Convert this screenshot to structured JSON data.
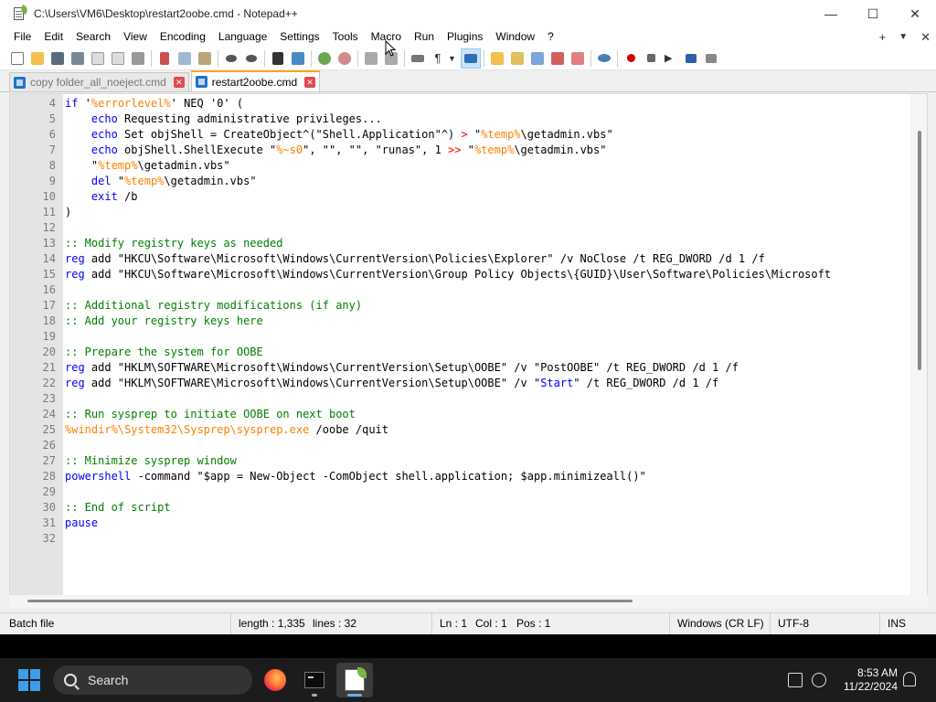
{
  "window": {
    "title": "C:\\Users\\VM6\\Desktop\\restart2oobe.cmd - Notepad++",
    "controls": {
      "minimize": "—",
      "maximize": "☐",
      "close": "✕"
    }
  },
  "menu": {
    "items": [
      "File",
      "Edit",
      "Search",
      "View",
      "Encoding",
      "Language",
      "Settings",
      "Tools",
      "Macro",
      "Run",
      "Plugins",
      "Window",
      "?"
    ],
    "right": {
      "add": "+",
      "dropdown": "▼",
      "close": "✕"
    }
  },
  "tabs": [
    {
      "label": "copy folder_all_noeject.cmd",
      "active": false
    },
    {
      "label": "restart2oobe.cmd",
      "active": true
    }
  ],
  "code_lines": [
    {
      "n": "4",
      "segs": [
        [
          "kw",
          "if "
        ],
        [
          "",
          "'"
        ],
        [
          "var",
          "%errorlevel%"
        ],
        [
          "",
          "' NEQ '0' ("
        ]
      ]
    },
    {
      "n": "5",
      "segs": [
        [
          "",
          "    "
        ],
        [
          "kw",
          "echo"
        ],
        [
          "",
          " Requesting administrative privileges..."
        ]
      ]
    },
    {
      "n": "6",
      "segs": [
        [
          "",
          "    "
        ],
        [
          "kw",
          "echo"
        ],
        [
          "",
          " Set objShell = CreateObject^(\"Shell.Application\"^) "
        ],
        [
          "op",
          ">"
        ],
        [
          "",
          " \""
        ],
        [
          "var",
          "%temp%"
        ],
        [
          "",
          "\\getadmin.vbs\""
        ]
      ]
    },
    {
      "n": "7",
      "segs": [
        [
          "",
          "    "
        ],
        [
          "kw",
          "echo"
        ],
        [
          "",
          " objShell.ShellExecute \""
        ],
        [
          "var",
          "%~s0"
        ],
        [
          "",
          "\", \"\", \"\", \"runas\", 1 "
        ],
        [
          "op",
          ">>"
        ],
        [
          "",
          " \""
        ],
        [
          "var",
          "%temp%"
        ],
        [
          "",
          "\\getadmin.vbs\""
        ]
      ]
    },
    {
      "n": "8",
      "segs": [
        [
          "",
          "    \""
        ],
        [
          "var",
          "%temp%"
        ],
        [
          "",
          "\\getadmin.vbs\""
        ]
      ]
    },
    {
      "n": "9",
      "segs": [
        [
          "",
          "    "
        ],
        [
          "kw",
          "del"
        ],
        [
          "",
          " \""
        ],
        [
          "var",
          "%temp%"
        ],
        [
          "",
          "\\getadmin.vbs\""
        ]
      ]
    },
    {
      "n": "10",
      "segs": [
        [
          "",
          "    "
        ],
        [
          "kw",
          "exit"
        ],
        [
          "",
          " /b"
        ]
      ]
    },
    {
      "n": "11",
      "segs": [
        [
          "",
          ")"
        ]
      ]
    },
    {
      "n": "12",
      "segs": []
    },
    {
      "n": "13",
      "segs": [
        [
          "cm",
          ":: Modify registry keys as needed"
        ]
      ]
    },
    {
      "n": "14",
      "segs": [
        [
          "kw",
          "reg"
        ],
        [
          "",
          " add \"HKCU\\Software\\Microsoft\\Windows\\CurrentVersion\\Policies\\Explorer\" /v NoClose /t REG_DWORD /d 1 /f"
        ]
      ]
    },
    {
      "n": "15",
      "segs": [
        [
          "kw",
          "reg"
        ],
        [
          "",
          " add \"HKCU\\Software\\Microsoft\\Windows\\CurrentVersion\\Group Policy Objects\\{GUID}\\User\\Software\\Policies\\Microsoft"
        ]
      ]
    },
    {
      "n": "16",
      "segs": []
    },
    {
      "n": "17",
      "segs": [
        [
          "cm",
          ":: Additional registry modifications (if any)"
        ]
      ]
    },
    {
      "n": "18",
      "segs": [
        [
          "cm",
          ":: Add your registry keys here"
        ]
      ]
    },
    {
      "n": "19",
      "segs": []
    },
    {
      "n": "20",
      "segs": [
        [
          "cm",
          ":: Prepare the system for OOBE"
        ]
      ]
    },
    {
      "n": "21",
      "segs": [
        [
          "kw",
          "reg"
        ],
        [
          "",
          " add \"HKLM\\SOFTWARE\\Microsoft\\Windows\\CurrentVersion\\Setup\\OOBE\" /v \"PostOOBE\" /t REG_DWORD /d 1 /f"
        ]
      ]
    },
    {
      "n": "22",
      "segs": [
        [
          "kw",
          "reg"
        ],
        [
          "",
          " add \"HKLM\\SOFTWARE\\Microsoft\\Windows\\CurrentVersion\\Setup\\OOBE\" /v \""
        ],
        [
          "kw",
          "Start"
        ],
        [
          "",
          "\" /t REG_DWORD /d 1 /f"
        ]
      ]
    },
    {
      "n": "23",
      "segs": []
    },
    {
      "n": "24",
      "segs": [
        [
          "cm",
          ":: Run sysprep to initiate OOBE on next boot"
        ]
      ]
    },
    {
      "n": "25",
      "segs": [
        [
          "var",
          "%windir%"
        ],
        [
          "var",
          "\\System32\\Sysprep\\sysprep.exe"
        ],
        [
          "",
          " /oobe /quit"
        ]
      ]
    },
    {
      "n": "26",
      "segs": []
    },
    {
      "n": "27",
      "segs": [
        [
          "cm",
          ":: Minimize sysprep window"
        ]
      ]
    },
    {
      "n": "28",
      "segs": [
        [
          "kw",
          "powershell"
        ],
        [
          "",
          " -command \"$app = New-Object -ComObject shell.application; $app.minimizeall()\""
        ]
      ]
    },
    {
      "n": "29",
      "segs": []
    },
    {
      "n": "30",
      "segs": [
        [
          "cm",
          ":: End of script"
        ]
      ]
    },
    {
      "n": "31",
      "segs": [
        [
          "kw",
          "pause"
        ]
      ]
    },
    {
      "n": "32",
      "segs": []
    }
  ],
  "status": {
    "type": "Batch file",
    "length": "length : 1,335",
    "lines": "lines : 32",
    "ln": "Ln : 1",
    "col": "Col : 1",
    "pos": "Pos : 1",
    "eol": "Windows (CR LF)",
    "encoding": "UTF-8",
    "mode": "INS"
  },
  "taskbar": {
    "search_label": "Search",
    "time": "8:53 AM",
    "date": "11/22/2024"
  },
  "colors": {
    "keyword": "#0000ff",
    "comment": "#008000",
    "variable": "#ff8000",
    "operator": "#ff0000",
    "tab_accent": "#f5a623"
  }
}
